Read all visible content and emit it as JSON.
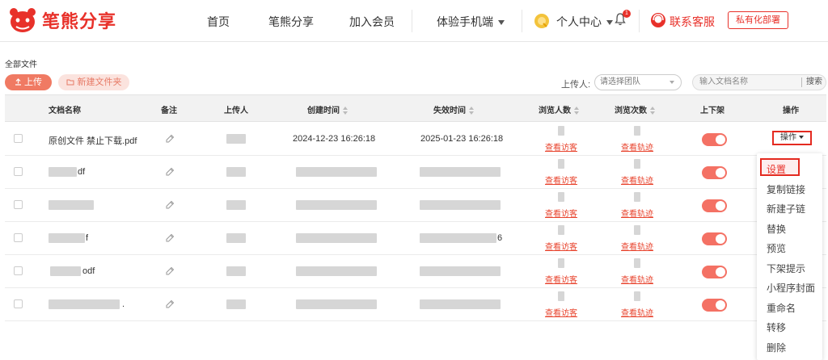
{
  "brand": {
    "name": "笔熊分享",
    "color": "#e8312a"
  },
  "nav": {
    "items": [
      "首页",
      "笔熊分享",
      "加入会员",
      "体验手机端"
    ],
    "user_center": "个人中心",
    "bell_count": "1",
    "support": "联系客服",
    "private_deploy": "私有化部署"
  },
  "toolbar": {
    "breadcrumb": "全部文件",
    "upload": "上传",
    "new_folder": "新建文件夹",
    "uploader_label": "上传人:",
    "team_placeholder": "请选择团队",
    "search_placeholder": "输入文档名称",
    "search_button": "搜索"
  },
  "table": {
    "headers": [
      "文档名称",
      "备注",
      "上传人",
      "创建时间",
      "失效时间",
      "浏览人数",
      "浏览次数",
      "上下架",
      "操作"
    ],
    "rows": [
      {
        "name": "原创文件 禁止下载.pdf",
        "created": "2024-12-23 16:26:18",
        "expires": "2025-01-23 16:26:18",
        "visitors_link": "查看访客",
        "track_link": "查看轨迹",
        "listed": true
      },
      {
        "name": "df",
        "created": "",
        "expires": "",
        "visitors_link": "查看访客",
        "track_link": "查看轨迹",
        "listed": true
      },
      {
        "name": "",
        "created": "",
        "expires": "",
        "visitors_link": "查看访客",
        "track_link": "查看轨迹",
        "listed": true
      },
      {
        "name": "f",
        "created": "",
        "expires": "6",
        "visitors_link": "查看访客",
        "track_link": "查看轨迹",
        "listed": true
      },
      {
        "name": "odf",
        "created": "",
        "expires": "",
        "visitors_link": "查看访客",
        "track_link": "查看轨迹",
        "listed": true
      },
      {
        "name": ".",
        "created": "",
        "expires": "",
        "visitors_link": "查看访客",
        "track_link": "查看轨迹",
        "listed": true
      }
    ],
    "op_button": "操作"
  },
  "dropdown": {
    "items": [
      "设置",
      "复制链接",
      "新建子链",
      "替换",
      "预览",
      "下架提示",
      "小程序封面",
      "重命名",
      "转移",
      "删除"
    ]
  }
}
